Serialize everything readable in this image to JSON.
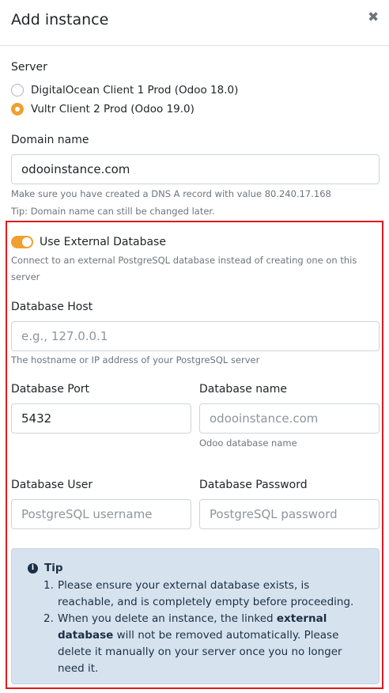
{
  "modal": {
    "title": "Add instance",
    "close_glyph": "✖"
  },
  "server": {
    "label": "Server",
    "options": [
      {
        "label": "DigitalOcean Client 1 Prod (Odoo 18.0)",
        "checked": false
      },
      {
        "label": "Vultr Client 2 Prod (Odoo 19.0)",
        "checked": true
      }
    ]
  },
  "domain": {
    "label": "Domain name",
    "value": "odooinstance.com",
    "help_dns": "Make sure you have created a DNS A record with value 80.240.17.168",
    "help_tip": "Tip: Domain name can still be changed later."
  },
  "external_db": {
    "toggle_label": "Use External Database",
    "toggle_on": true,
    "description_line1": "Connect to an external PostgreSQL database instead of creating one on this",
    "description_line2": "server"
  },
  "db_host": {
    "label": "Database Host",
    "placeholder": "e.g., 127.0.0.1",
    "help": "The hostname or IP address of your PostgreSQL server"
  },
  "db_port": {
    "label": "Database Port",
    "value": "5432"
  },
  "db_name": {
    "label": "Database name",
    "placeholder": "odooinstance.com",
    "help": "Odoo database name"
  },
  "db_user": {
    "label": "Database User",
    "placeholder": "PostgreSQL username"
  },
  "db_password": {
    "label": "Database Password",
    "placeholder": "PostgreSQL password"
  },
  "tip": {
    "icon": "info-icon",
    "title": "Tip",
    "item1_num": "1.",
    "item1_text": "Please ensure your external database exists, is reachable, and is completely empty before proceeding.",
    "item2_num": "2.",
    "item2_pre": "When you delete an instance, the linked ",
    "item2_bold": "external database",
    "item2_post": " will not be removed automatically. Please delete it manually on your server once you no longer need it."
  },
  "colors": {
    "accent": "#f0a030",
    "highlight_outline": "#e3191c",
    "tip_background": "#d6e3ef",
    "tip_text": "#1c2f44"
  }
}
